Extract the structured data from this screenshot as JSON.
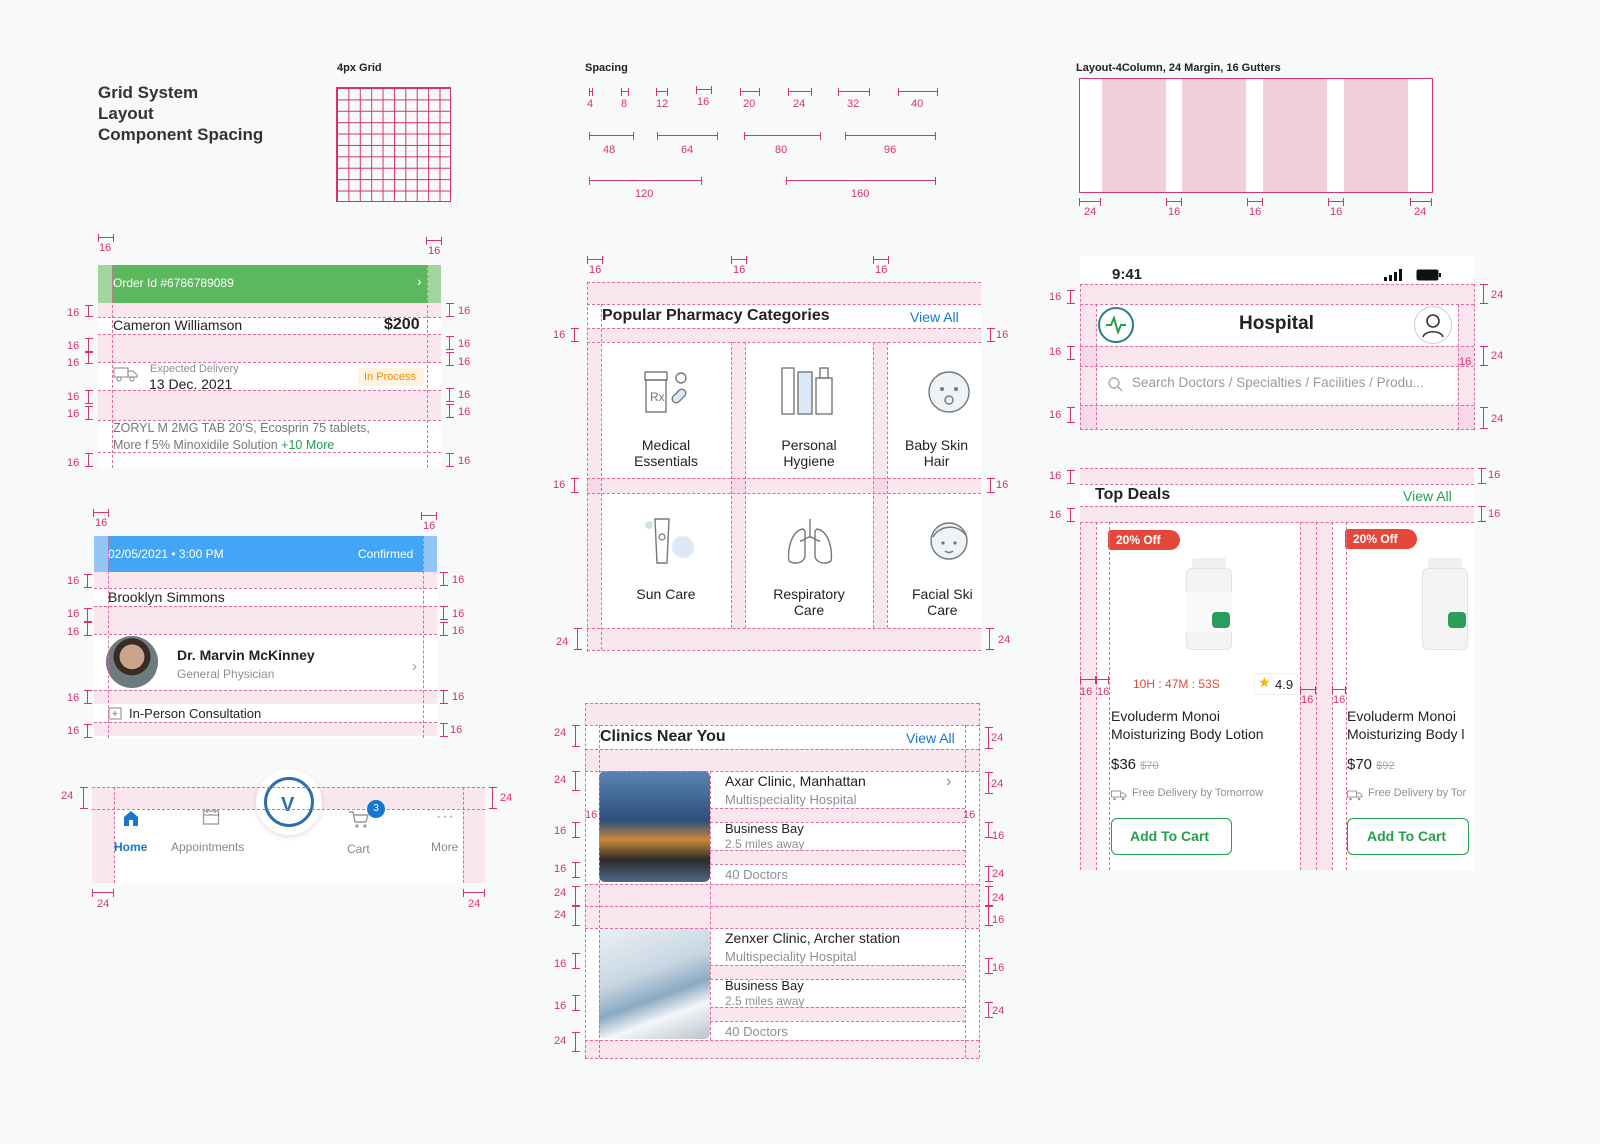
{
  "doc_title_lines": [
    "Grid System",
    "Layout",
    "Component Spacing"
  ],
  "grid_label": "4px Grid",
  "spacing_label": "Spacing",
  "spacing_values": [
    "4",
    "8",
    "12",
    "16",
    "20",
    "24",
    "32",
    "40",
    "48",
    "64",
    "80",
    "96",
    "120",
    "160"
  ],
  "layout_label": "Layout-4Column, 24 Margin, 16 Gutters",
  "layout_marks": [
    "24",
    "16",
    "16",
    "16",
    "24"
  ],
  "order": {
    "id": "Order Id #6786789089",
    "name": "Cameron Williamson",
    "amount": "$200",
    "delivery_label": "Expected Delivery",
    "delivery_date": "13 Dec. 2021",
    "status": "In Process",
    "items_line1": "ZORYL M 2MG TAB 20'S, Ecosprin 75 tablets,",
    "items_line2": "More f 5% Minoxidile Solution",
    "more": "+10 More",
    "marks": [
      "16",
      "16",
      "16",
      "16",
      "16",
      "16",
      "16",
      "16",
      "16",
      "16",
      "16",
      "16",
      "16",
      "16"
    ]
  },
  "appointment": {
    "datetime": "02/05/2021 • 3:00 PM",
    "status": "Confirmed",
    "patient": "Brooklyn Simmons",
    "doctor": "Dr. Marvin McKinney",
    "specialty": "General Physician",
    "type": "In-Person Consultation",
    "marks": [
      "16",
      "16",
      "16",
      "16",
      "16",
      "16",
      "16",
      "16",
      "16",
      "16",
      "16",
      "16"
    ]
  },
  "tabbar": {
    "items": [
      "Home",
      "Appointments",
      "Cart",
      "More"
    ],
    "cart_badge": "3",
    "marks": [
      "24",
      "24",
      "24",
      "24"
    ]
  },
  "categories": {
    "title": "Popular Pharmacy Categories",
    "view_all": "View All",
    "items": [
      [
        "Medical",
        "Essentials"
      ],
      [
        "Personal",
        "Hygiene"
      ],
      [
        "Baby Skin",
        "Hair"
      ],
      [
        "Sun Care",
        ""
      ],
      [
        "Respiratory",
        "Care"
      ],
      [
        "Facial Ski",
        "Care"
      ]
    ],
    "marks": [
      "16",
      "16",
      "16",
      "16",
      "16",
      "16",
      "16",
      "24",
      "24"
    ]
  },
  "clinics": {
    "title": "Clinics Near You",
    "view_all": "View All",
    "items": [
      {
        "name": "Axar Clinic, Manhattan",
        "type": "Multispeciality Hospital",
        "area": "Business Bay",
        "distance": "2.5 miles away",
        "doctors": "40 Doctors"
      },
      {
        "name": "Zenxer Clinic, Archer station",
        "type": "Multispeciality Hospital",
        "area": "Business Bay",
        "distance": "2.5 miles away",
        "doctors": "40 Doctors"
      }
    ],
    "marks": [
      "24",
      "24",
      "24",
      "24",
      "16",
      "16",
      "16",
      "16",
      "16",
      "24",
      "24",
      "24",
      "24",
      "16",
      "16",
      "16",
      "16",
      "24",
      "24"
    ]
  },
  "hospital": {
    "time": "9:41",
    "title": "Hospital",
    "search_placeholder": "Search Doctors / Specialties / Facilities / Produ...",
    "marks": [
      "16",
      "24",
      "16",
      "24",
      "16",
      "16",
      "24"
    ]
  },
  "deals": {
    "title": "Top Deals",
    "view_all": "View All",
    "timer": "10H : 47M : 53S",
    "rating": "4.9",
    "items": [
      {
        "discount": "20% Off",
        "name1": "Evoluderm Monoi",
        "name2": "Moisturizing Body Lotion",
        "price": "$36",
        "old": "$70",
        "delivery": "Free Delivery by Tomorrow",
        "cta": "Add To Cart"
      },
      {
        "discount": "20% Off",
        "name1": "Evoluderm Monoi",
        "name2": "Moisturizing Body l",
        "price": "$70",
        "old": "$92",
        "delivery": "Free Delivery by Tor",
        "cta": "Add To Cart"
      }
    ],
    "marks": [
      "16",
      "16",
      "16",
      "16",
      "16",
      "16",
      "16",
      "16"
    ]
  },
  "colors": {
    "accent_green": "#5cb85c",
    "accent_blue": "#42a5f5",
    "guide_pink": "#d6336c",
    "link_green": "#23a04a",
    "badge_red": "#e5483a"
  }
}
